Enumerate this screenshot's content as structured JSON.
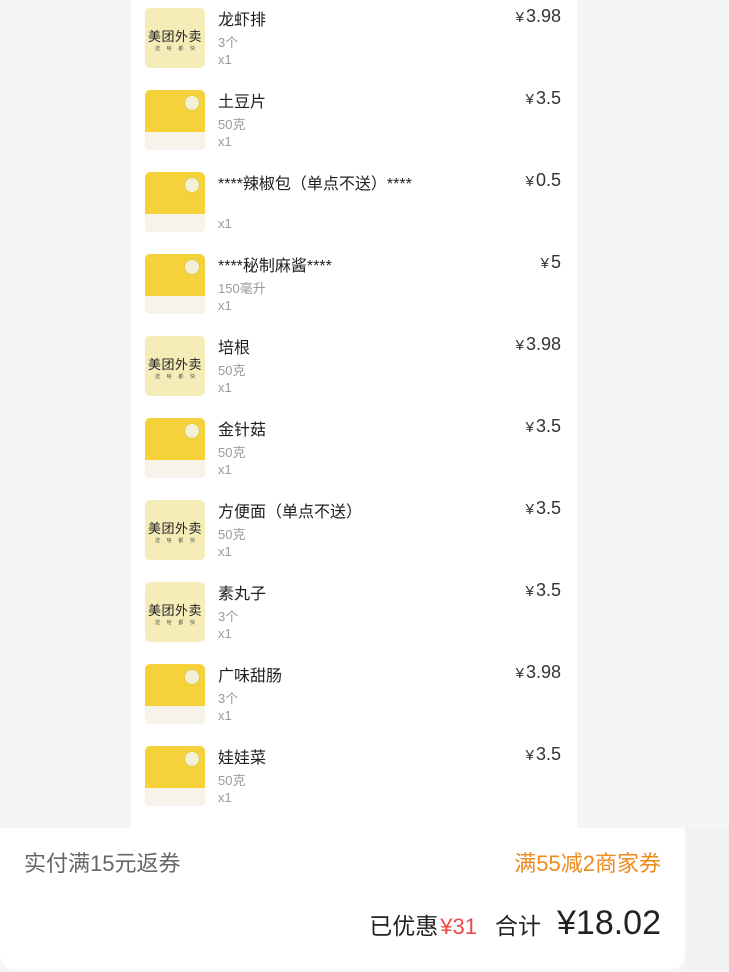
{
  "items": [
    {
      "name": "龙虾排",
      "spec": "3个",
      "qty": "x1",
      "price": "3.98",
      "thumb": "logo"
    },
    {
      "name": "土豆片",
      "spec": "50克",
      "qty": "x1",
      "price": "3.5",
      "thumb": "photo"
    },
    {
      "name": "****辣椒包（单点不送）****",
      "spec": "",
      "qty": "x1",
      "price": "0.5",
      "thumb": "photo"
    },
    {
      "name": "****秘制麻酱****",
      "spec": "150毫升",
      "qty": "x1",
      "price": "5",
      "thumb": "photo"
    },
    {
      "name": "培根",
      "spec": "50克",
      "qty": "x1",
      "price": "3.98",
      "thumb": "logo"
    },
    {
      "name": "金针菇",
      "spec": "50克",
      "qty": "x1",
      "price": "3.5",
      "thumb": "photo"
    },
    {
      "name": "方便面（单点不送）",
      "spec": "50克",
      "qty": "x1",
      "price": "3.5",
      "thumb": "logo"
    },
    {
      "name": "素丸子",
      "spec": "3个",
      "qty": "x1",
      "price": "3.5",
      "thumb": "logo"
    },
    {
      "name": "广味甜肠",
      "spec": "3个",
      "qty": "x1",
      "price": "3.98",
      "thumb": "photo"
    },
    {
      "name": "娃娃菜",
      "spec": "50克",
      "qty": "x1",
      "price": "3.5",
      "thumb": "photo"
    }
  ],
  "currency": "¥",
  "logo_text": "美团外卖",
  "logo_sub": [
    "送",
    "啥",
    "都",
    "快"
  ],
  "footer": {
    "rebate": "实付满15元返券",
    "merchant_coupon": "满55减2商家券",
    "discount_label": "已优惠",
    "discount_value": "¥31",
    "total_label": "合计",
    "total_value": "¥18.02"
  },
  "colors": {
    "accent_orange": "#f08a1c",
    "discount_red": "#f04545",
    "logo_bg": "#f5ecb8",
    "photo_bg": "#f6d23a"
  }
}
